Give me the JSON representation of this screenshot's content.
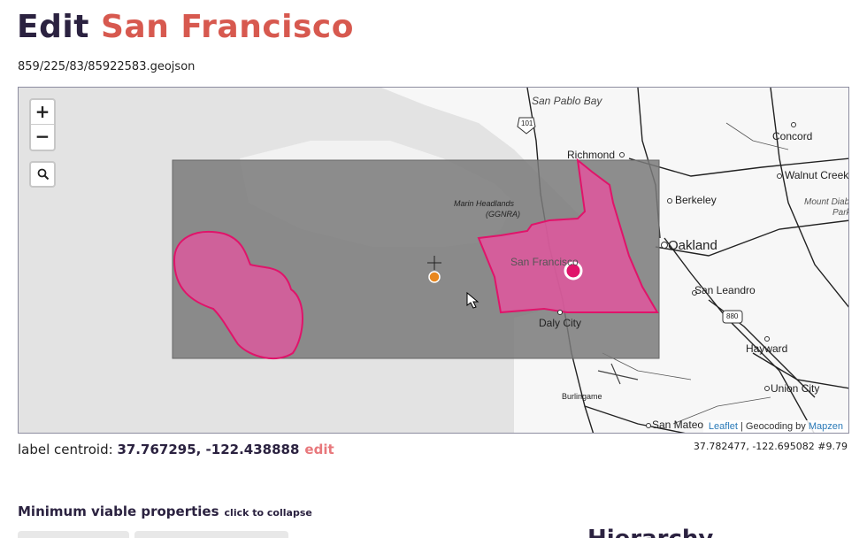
{
  "page": {
    "title_prefix": "Edit",
    "title_place": "San Francisco",
    "path": "859/225/83/85922583.geojson"
  },
  "map": {
    "zoom_in": "+",
    "zoom_out": "−",
    "search_icon": "search-icon",
    "labels": {
      "san_pablo_bay": "San Pablo Bay",
      "richmond": "Richmond",
      "concord": "Concord",
      "walnut_creek": "Walnut Creek",
      "mount_diablo": "Mount Diab",
      "park": "Park",
      "berkeley": "Berkeley",
      "marin": "Marin Headlands",
      "ggnra": "(GGNRA)",
      "oakland": "Oakland",
      "san_francisco": "San Francisco",
      "san_leandro": "San Leandro",
      "daly_city": "Daly City",
      "hayward": "Hayward",
      "union_city": "Union City",
      "burlingame": "Burlingame",
      "san_mateo": "San Mateo",
      "shield_101": "101",
      "shield_880": "880"
    },
    "attribution": {
      "leaflet": "Leaflet",
      "separator": " | Geocoding by ",
      "provider": "Mapzen"
    },
    "colors": {
      "bbox_fill": "#7a7a7a",
      "polygon_fill": "#e0569e",
      "polygon_stroke": "#e0146a",
      "centroid_marker": "#e0146a",
      "geom_centroid": "#e8871e"
    }
  },
  "centroid": {
    "prefix": "label centroid: ",
    "coords": "37.767295, -122.438888",
    "edit": "edit"
  },
  "cursor_position": "37.782477, -122.695082 #9.79",
  "sections": {
    "min_viable": "Minimum viable properties",
    "collapse": "click to collapse",
    "hierarchy": "Hierarchy"
  }
}
